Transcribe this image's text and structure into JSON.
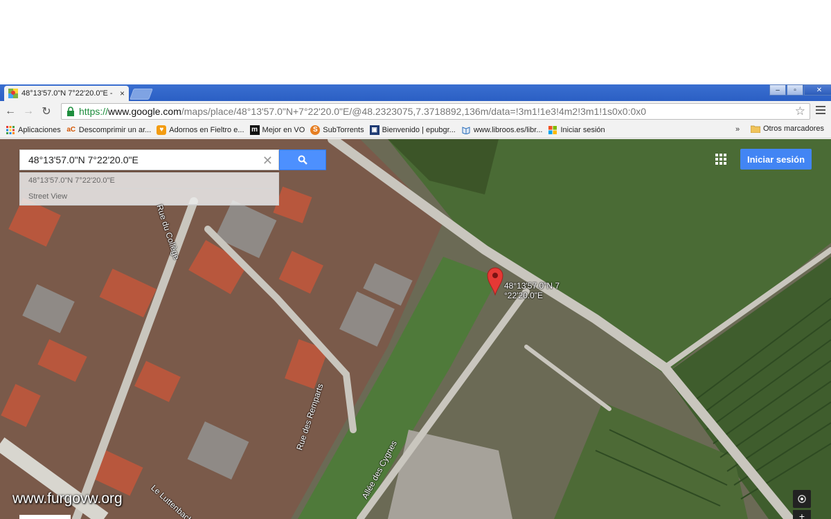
{
  "browser": {
    "tab_title": "48°13'57.0\"N 7°22'20.0\"E -",
    "tab_close": "×",
    "url_scheme": "https://",
    "url_host": "www.google.com",
    "url_path": "/maps/place/48°13'57.0\"N+7°22'20.0\"E/@48.2323075,7.3718892,136m/data=!3m1!1e3!4m2!3m1!1s0x0:0x0",
    "back_glyph": "←",
    "forward_glyph": "→",
    "reload_glyph": "↻",
    "star_glyph": "☆",
    "window_buttons": [
      "–",
      "▫",
      "✕"
    ]
  },
  "bookmarks": {
    "items": [
      {
        "label": "Aplicaciones",
        "icon": "apps-icon"
      },
      {
        "label": "Descomprimir un ar...",
        "icon": "ac-icon",
        "glyph": "aC",
        "color": "#d35400"
      },
      {
        "label": "Adornos en Fieltro e...",
        "icon": "fieltro-icon",
        "glyph": "♥",
        "color": "#f39c12"
      },
      {
        "label": "Mejor en VO",
        "icon": "m-icon",
        "glyph": "m",
        "color": "#111111"
      },
      {
        "label": "SubTorrents",
        "icon": "subtorrents-icon",
        "glyph": "S",
        "color": "#e67e22"
      },
      {
        "label": "Bienvenido | epubgr...",
        "icon": "epub-icon",
        "glyph": "▣",
        "color": "#1f3b73"
      },
      {
        "label": "www.libroos.es/libr...",
        "icon": "libroos-icon",
        "glyph": "📖",
        "color": "#2c6fbb"
      },
      {
        "label": "Iniciar sesión",
        "icon": "windows-icon"
      }
    ],
    "overflow": "»",
    "other": "Otros marcadores"
  },
  "map": {
    "search_value": "48°13'57.0\"N 7°22'20.0\"E",
    "suggestions": [
      "48°13'57.0\"N 7°22'20.0\"E",
      "Street View"
    ],
    "sign_in": "Iniciar sesión",
    "marker_label": "48°13'57.0\"N 7\n°22'20.0\"E",
    "streets": {
      "college": "Rue du Collège",
      "remparts": "Rue des Remparts",
      "cygnes": "Allée des Cygnes",
      "luttenbach": "Le Luttenbach"
    },
    "zoom_in": "+",
    "watermark": "www.furgovw.org",
    "colors": {
      "accent": "#4285f4",
      "search_button": "#4d90fe",
      "marker": "#e53935"
    }
  }
}
